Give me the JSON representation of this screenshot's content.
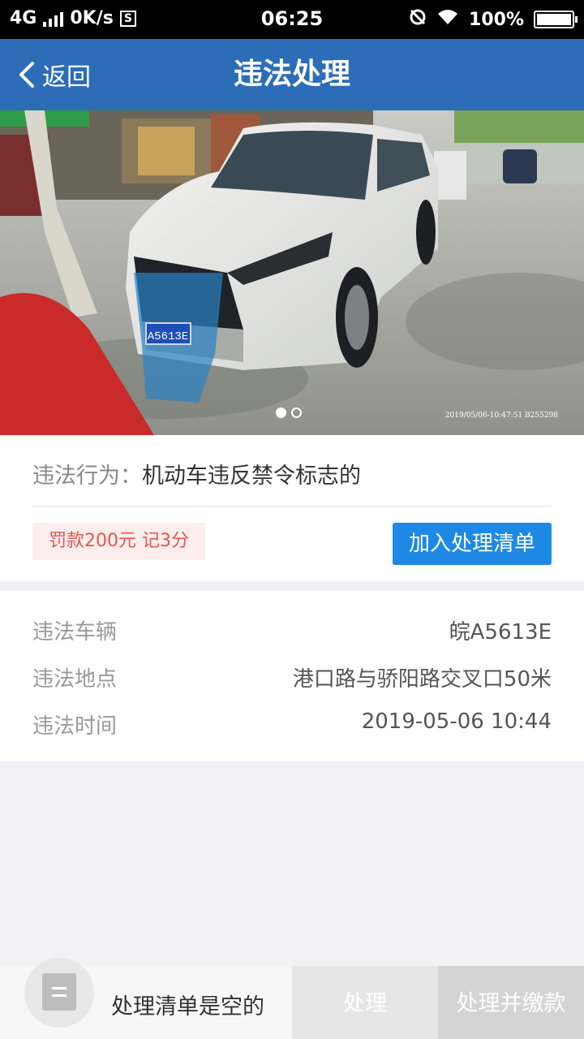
{
  "status_bar": {
    "network": "4G",
    "speed": "0K/s",
    "s_icon": "S",
    "time": "06:25",
    "battery": "100%",
    "battery_level": 1.0
  },
  "nav": {
    "back_label": "返回",
    "title": "违法处理"
  },
  "photo": {
    "plate_text": "A5613E",
    "timestamp": "2019/05/06-10:47:51 B255298",
    "page_count": 2,
    "current_page": 1
  },
  "violation": {
    "behavior_label": "违法行为：",
    "behavior_value": "机动车违反禁令标志的",
    "fine_tag": "罚款200元 记3分",
    "add_button": "加入处理清单"
  },
  "details": {
    "vehicle_label": "违法车辆",
    "vehicle_value": "皖A5613E",
    "location_label": "违法地点",
    "location_value": "港口路与骄阳路交叉口50米",
    "time_label": "违法时间",
    "time_value": "2019-05-06 10:44"
  },
  "bottom_bar": {
    "empty_text": "处理清单是空的",
    "process_button": "处理",
    "process_pay_button": "处理并缴款"
  },
  "colors": {
    "nav": "#2d6db8",
    "primary_button": "#1e88e5",
    "fine_text": "#e0584f",
    "fine_bg": "#fdeeee"
  }
}
